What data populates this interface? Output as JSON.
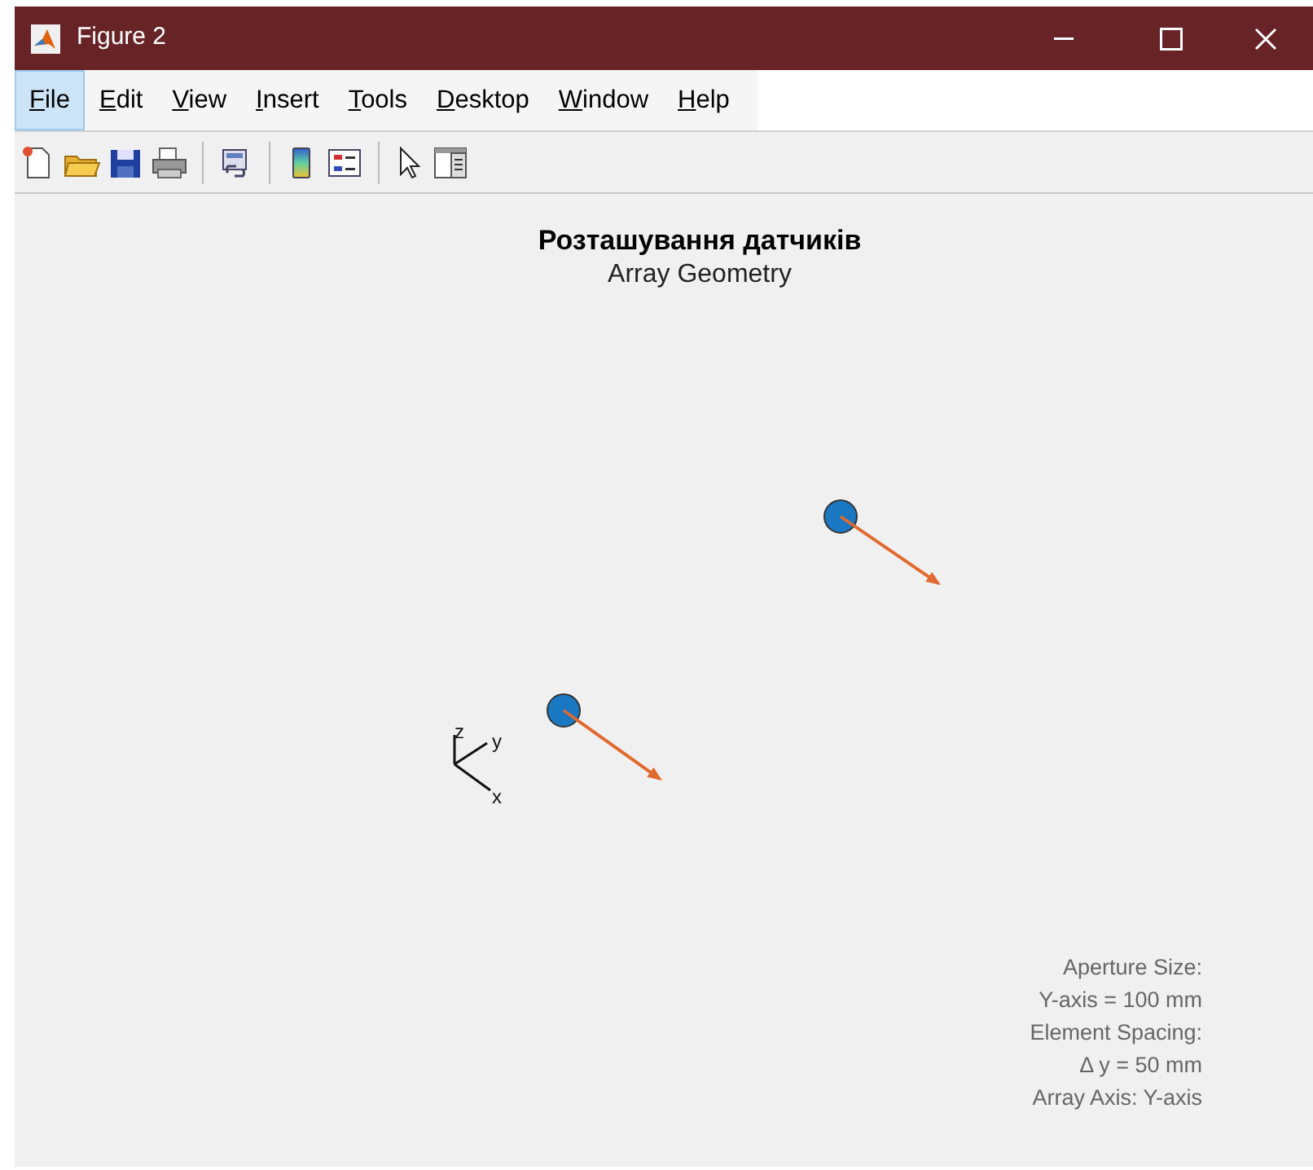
{
  "window": {
    "title": "Figure 2"
  },
  "menu": [
    {
      "label": "File",
      "selected": true
    },
    {
      "label": "Edit",
      "selected": false
    },
    {
      "label": "View",
      "selected": false
    },
    {
      "label": "Insert",
      "selected": false
    },
    {
      "label": "Tools",
      "selected": false
    },
    {
      "label": "Desktop",
      "selected": false
    },
    {
      "label": "Window",
      "selected": false
    },
    {
      "label": "Help",
      "selected": false
    }
  ],
  "plot": {
    "title": "Розташування датчиків",
    "subtitle": "Array Geometry",
    "axes_triad": {
      "z": "z",
      "y": "y",
      "x": "x"
    },
    "annotation": [
      "Aperture Size:",
      "Y-axis = 100 mm",
      "Element Spacing:",
      "Δ y = 50 mm",
      "Array Axis: Y-axis"
    ]
  }
}
